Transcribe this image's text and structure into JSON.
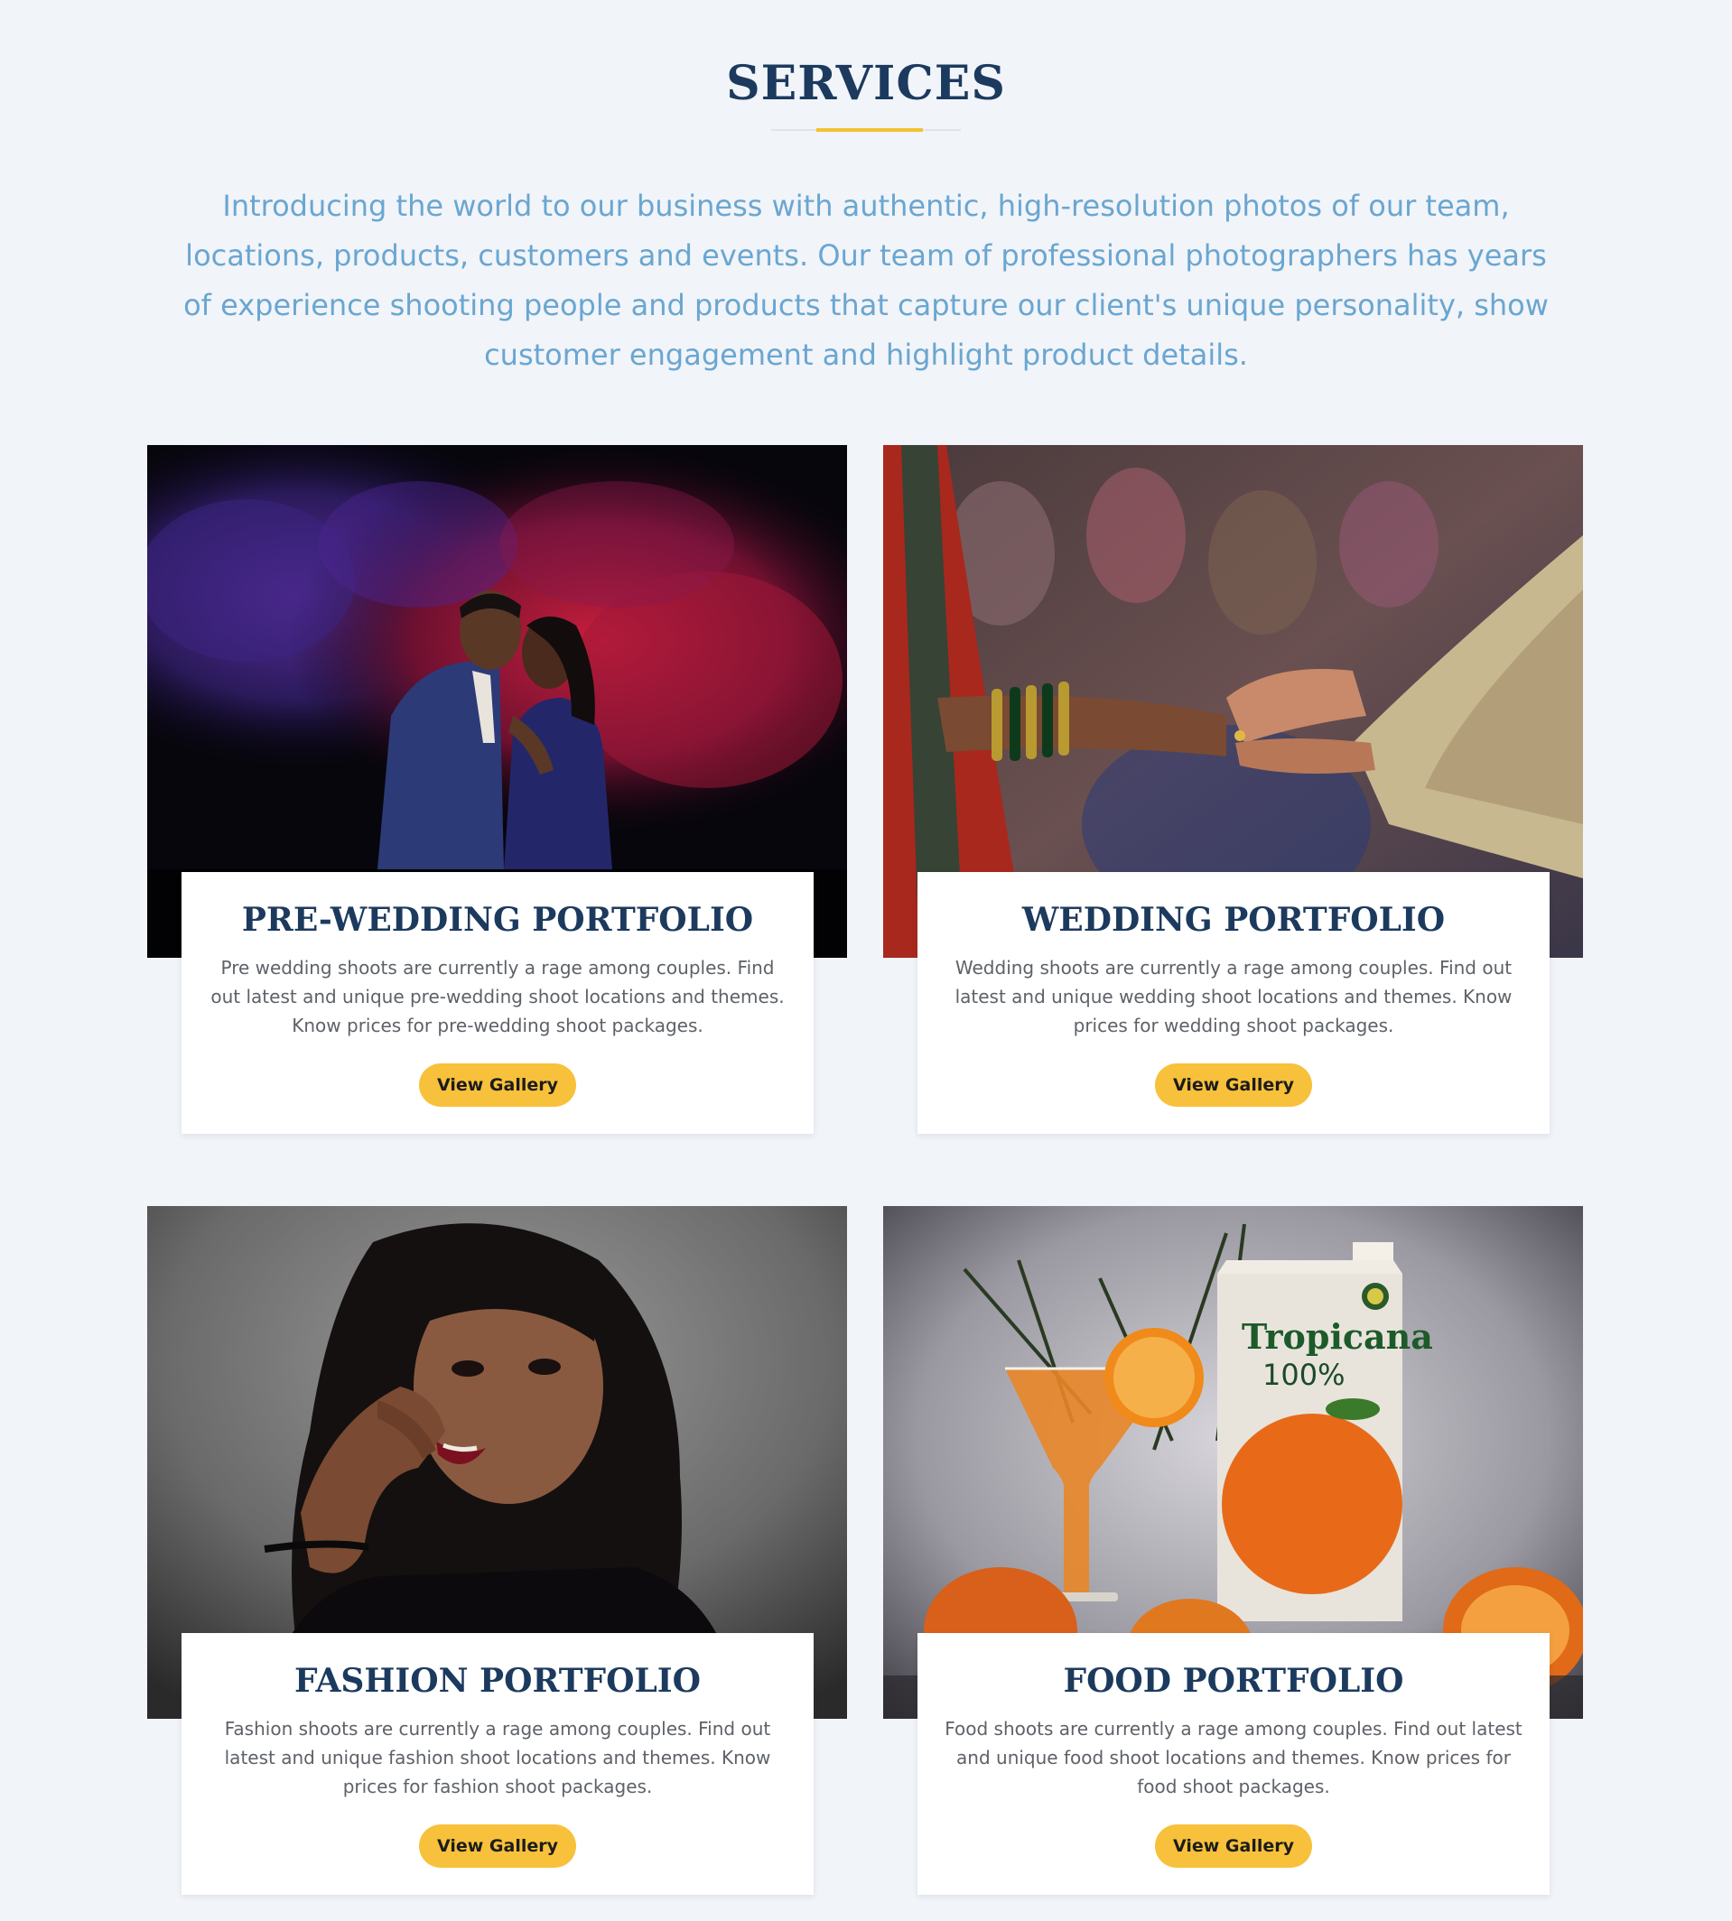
{
  "section": {
    "title": "SERVICES",
    "intro": "Introducing the world to our business with authentic, high-resolution photos of our team, locations, products, customers and events. Our team of professional photographers has years of experience shooting people and products that capture our client's unique personality, show customer engagement and highlight product details."
  },
  "colors": {
    "title": "#1c3a5e",
    "intro": "#6aa6d0",
    "accent": "#f2c230",
    "button": "#f8c13b",
    "background": "#f1f4f9"
  },
  "cards": [
    {
      "title": "PRE-WEDDING PORTFOLIO",
      "description": "Pre wedding shoots are currently a rage among couples. Find out latest and unique pre-wedding shoot locations and themes. Know prices for pre-wedding shoot packages.",
      "button": "View Gallery",
      "image": "couple-embrace-photo"
    },
    {
      "title": "WEDDING PORTFOLIO",
      "description": "Wedding shoots are currently a rage among couples. Find out latest and unique wedding shoot locations and themes. Know prices for wedding shoot packages.",
      "button": "View Gallery",
      "image": "ring-exchange-photo"
    },
    {
      "title": "FASHION PORTFOLIO",
      "description": "Fashion shoots are currently a rage among couples. Find out latest and unique fashion shoot locations and themes. Know prices for fashion shoot packages.",
      "button": "View Gallery",
      "image": "fashion-portrait-photo"
    },
    {
      "title": "FOOD PORTFOLIO",
      "description": "Food shoots are currently a rage among couples. Find out latest and unique food shoot locations and themes. Know prices for food shoot packages.",
      "button": "View Gallery",
      "image": "juice-carton-photo"
    }
  ],
  "food_photo": {
    "brand": "Tropicana",
    "badge": "100%"
  }
}
